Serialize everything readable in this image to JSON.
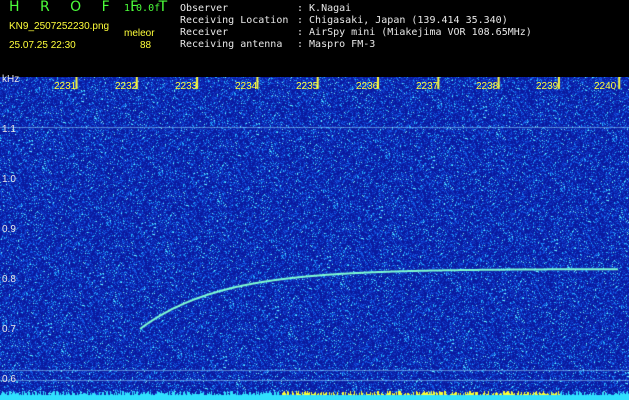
{
  "header": {
    "title": "H R O F F T",
    "version": "1.0.0f",
    "filename": "KN9_2507252230.png",
    "mode": "meleor",
    "datetime": "25.07.25 22:30",
    "count": "88"
  },
  "station": [
    {
      "label": "Observer",
      "value": ": K.Nagai"
    },
    {
      "label": "Receiving Location",
      "value": ": Chigasaki, Japan (139.414 35.340)"
    },
    {
      "label": "Receiver",
      "value": ": AirSpy mini (Miakejima VOR 108.65MHz)"
    },
    {
      "label": "Receiving antenna",
      "value": ": Maspro FM-3"
    }
  ],
  "axis": {
    "unit": "kHz",
    "y_ticks": [
      "1.1",
      "1.0",
      "0.9",
      "0.8",
      "0.7",
      "0.6"
    ],
    "x_ticks": [
      "2231",
      "2232",
      "2233",
      "2234",
      "2235",
      "2236",
      "2237",
      "2238",
      "2239",
      "2240"
    ]
  },
  "colors": {
    "background": "#0a1aa0",
    "noise": "#2ad8ff",
    "signal": "#7fffd4",
    "tick": "#ffff3a"
  }
}
